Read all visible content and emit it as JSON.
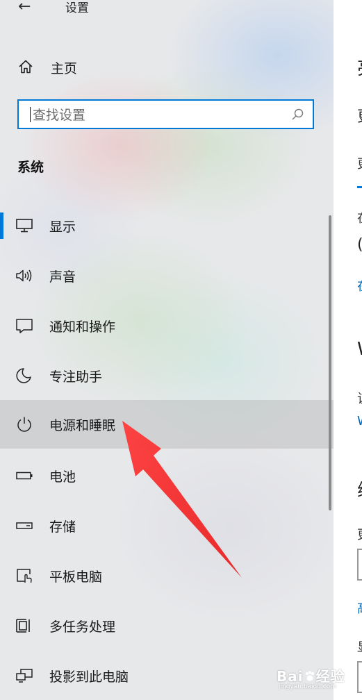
{
  "window": {
    "title": "设置"
  },
  "home": {
    "label": "主页"
  },
  "search": {
    "placeholder": "查找设置"
  },
  "section": {
    "title": "系统"
  },
  "nav": {
    "items": [
      {
        "label": "显示",
        "icon": "monitor-icon",
        "selected": true
      },
      {
        "label": "声音",
        "icon": "speaker-icon"
      },
      {
        "label": "通知和操作",
        "icon": "notification-icon"
      },
      {
        "label": "专注助手",
        "icon": "moon-icon"
      },
      {
        "label": "电源和睡眠",
        "icon": "power-icon",
        "hovered": true
      },
      {
        "label": "电池",
        "icon": "battery-icon"
      },
      {
        "label": "存储",
        "icon": "storage-icon"
      },
      {
        "label": "平板电脑",
        "icon": "tablet-icon"
      },
      {
        "label": "多任务处理",
        "icon": "multitasking-icon"
      },
      {
        "label": "投影到此电脑",
        "icon": "projection-icon"
      }
    ]
  },
  "content_fragments": {
    "f1": "亮",
    "f2": "更",
    "f3": "在",
    "f4": "(",
    "f5": "在",
    "f6": "W",
    "f7": "该",
    "f8": "W",
    "f9": "缩",
    "f10": "更",
    "f11": "高",
    "f12": "显"
  },
  "watermark": {
    "brand": "Bai",
    "brand2": "经验",
    "site": "jingyan.baidu.com"
  },
  "colors": {
    "accent": "#0078d7",
    "arrow": "#f23a3a",
    "link": "#0067b8"
  }
}
